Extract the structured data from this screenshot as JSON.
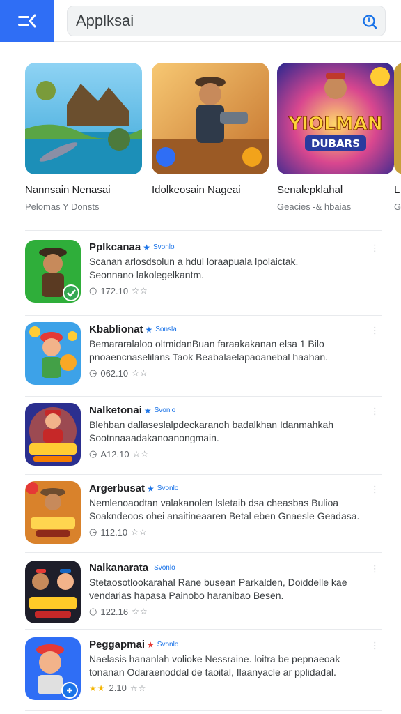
{
  "search": {
    "query": "Applksai"
  },
  "featured": [
    {
      "title": "Nannsain Nenasai",
      "subtitle": "Pelomas Y Donsts"
    },
    {
      "title": "Idolkeosain Nageai",
      "subtitle": ""
    },
    {
      "title": "Senalepklahal",
      "subtitle": "Geacies -& hbaias",
      "art_text_1": "YIOLMAN",
      "art_text_2": "DUBARS"
    },
    {
      "title": "L",
      "subtitle": "G"
    }
  ],
  "list": [
    {
      "name": "Pplkcanaa",
      "tag": "Svonlo",
      "desc_line1": "Scanan arlosdsolun a hdul loraapuala lpolaictak.",
      "desc_line2": "Seonnano lakolegelkantm.",
      "rating": "172.10",
      "stars_filled": 0,
      "stars_total": 2
    },
    {
      "name": "Kbablionat",
      "tag": "Sonsla",
      "desc_line1": "Bemararalaloo oltmidanBuan faraakakanan elsa 1 Bilo",
      "desc_line2": "pnoaencnaselilans Taok Beabalaelapaoanebal haahan.",
      "rating": "062.10",
      "stars_filled": 0,
      "stars_total": 2
    },
    {
      "name": "Nalketonai",
      "tag": "Svonlo",
      "desc_line1": "Blehban dallaseslalpdeckaranoh badalkhan Idanmahkah",
      "desc_line2": "Sootnnaaadakanoanongmain.",
      "rating": "A12.10",
      "stars_filled": 0,
      "stars_total": 2
    },
    {
      "name": "Argerbusat",
      "tag": "Svonlo",
      "desc_line1": "Nemlenoaodtan valakanolen lsletaib dsa cheasbas Bulioa",
      "desc_line2": "Soakndeoos ohei anaitineaaren Betal eben Gnaesle Geadasa.",
      "rating": "112.10",
      "stars_filled": 0,
      "stars_total": 2
    },
    {
      "name": "Nalkanarata",
      "tag": "Svonlo",
      "desc_line1": "Stetaosotlookarahal Rane busean Parkalden, Doiddelle kae",
      "desc_line2": "vendarias hapasa Painobo haranibao Besen.",
      "rating": "122.16",
      "stars_filled": 0,
      "stars_total": 2
    },
    {
      "name": "Peggapmai",
      "tag": "Svonlo",
      "desc_line1": "Naelasis hananlah volioke Nessraine. loitra be pepnaeoak",
      "desc_line2": "tonanan Odaraenoddal de taoital, Ilaanyacle ar pplidadal.",
      "rating": "2.10",
      "stars_filled": 2,
      "stars_total": 3
    }
  ],
  "colors": {
    "accent": "#2f6ef5",
    "link": "#1a73e8",
    "star": "#f4b400",
    "divider": "#e8eaed"
  }
}
